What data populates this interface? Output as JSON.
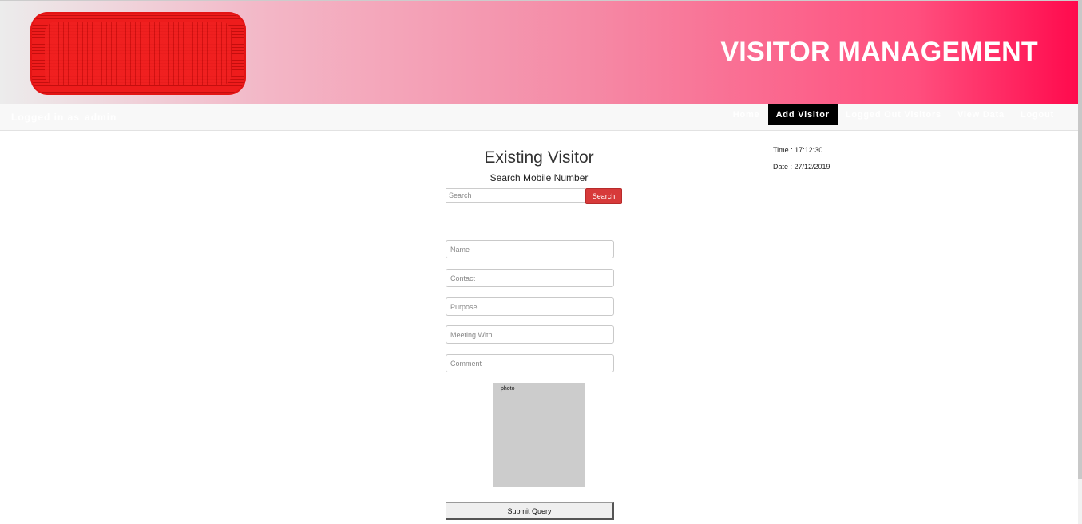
{
  "header": {
    "title": "VISITOR MANAGEMENT",
    "logo": "redacted-logo"
  },
  "nav": {
    "logged_in_label": "Logged in as",
    "username": "admin",
    "links": [
      {
        "label": "Home",
        "active": false
      },
      {
        "label": "Add Visitor",
        "active": true
      },
      {
        "label": "Logged Out Visitors",
        "active": false
      },
      {
        "label": "View Data",
        "active": false
      },
      {
        "label": "Logout",
        "active": false
      }
    ]
  },
  "clock": {
    "time": "Time : 17:12:30",
    "date": "Date : 27/12/2019"
  },
  "form": {
    "title": "Existing Visitor",
    "subtitle": "Search Mobile Number",
    "search_placeholder": "Search",
    "search_button": "Search",
    "fields": {
      "name": "Name",
      "contact": "Contact",
      "purpose": "Purpose",
      "meeting_with": "Meeting With",
      "comment": "Comment"
    },
    "photo_label": "photo",
    "submit_label": "Submit Query"
  },
  "colors": {
    "header_accent": "#ff0a4d",
    "search_button": "#d73a3a",
    "active_nav": "#000000"
  }
}
